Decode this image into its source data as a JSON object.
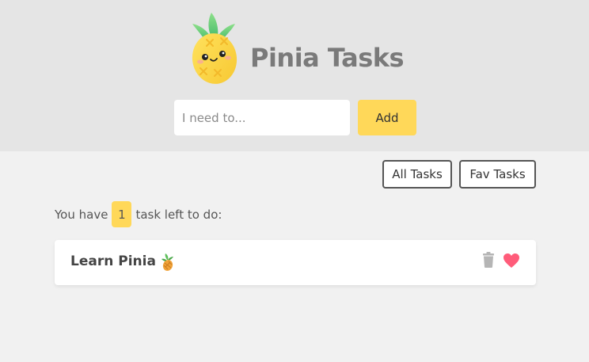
{
  "app": {
    "title": "Pinia Tasks",
    "logo_icon": "pineapple-icon"
  },
  "new_task": {
    "placeholder": "I need to...",
    "value": "",
    "add_label": "Add"
  },
  "filters": {
    "all_label": "All Tasks",
    "fav_label": "Fav Tasks"
  },
  "summary": {
    "prefix": "You have",
    "count": "1",
    "suffix": "task left to do:"
  },
  "tasks": [
    {
      "title": "Learn Pinia",
      "emoji_icon": "pineapple-icon",
      "delete_icon": "trash-icon",
      "favorite_icon": "heart-icon",
      "is_favorite": true
    }
  ],
  "colors": {
    "accent": "#ffd859",
    "header_bg": "#e5e5e5",
    "page_bg": "#f1f1f1",
    "favorite": "#ff5c7a",
    "trash": "#b5b5b5"
  }
}
